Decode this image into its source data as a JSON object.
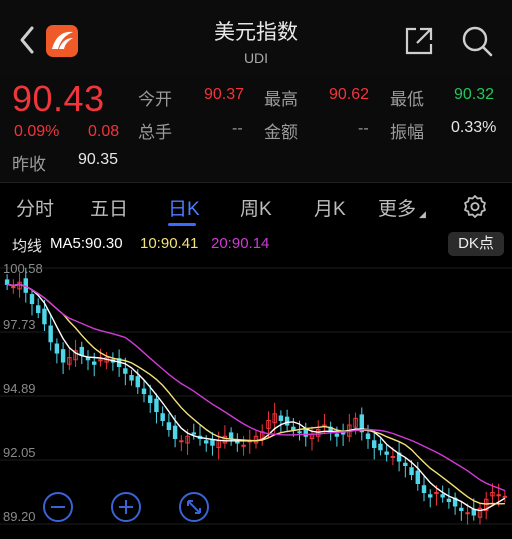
{
  "header": {
    "title": "美元指数",
    "subtitle": "UDI"
  },
  "quote": {
    "price": "90.43",
    "change_pct": "0.09%",
    "change": "0.08",
    "open_label": "今开",
    "open": "90.37",
    "high_label": "最高",
    "high": "90.62",
    "low_label": "最低",
    "low": "90.32",
    "volume_label": "总手",
    "volume": "--",
    "amount_label": "金额",
    "amount": "--",
    "amplitude_label": "振幅",
    "amplitude": "0.33%",
    "prev_close_label": "昨收",
    "prev_close": "90.35"
  },
  "tabs": [
    {
      "label": "分时"
    },
    {
      "label": "五日"
    },
    {
      "label": "日K"
    },
    {
      "label": "周K"
    },
    {
      "label": "月K"
    },
    {
      "label": "更多"
    }
  ],
  "active_tab": "日K",
  "ma": {
    "label": "均线",
    "ma5": "MA5:90.30",
    "ma10": "10:90.41",
    "ma20": "20:90.14",
    "dk_button": "DK点"
  },
  "colors": {
    "up": "#f0353b",
    "down": "#4fd6e8",
    "ma5": "#ffffff",
    "ma10": "#f3e27a",
    "ma20": "#d23ad8",
    "accent": "#3a6bff"
  },
  "icons": [
    "back-icon",
    "app-logo-icon",
    "share-icon",
    "search-icon",
    "settings-icon",
    "zoom-out-icon",
    "zoom-in-icon",
    "expand-icon"
  ],
  "chart_data": {
    "type": "candlestick",
    "y_tick_labels": [
      "100.58",
      "97.73",
      "94.89",
      "92.05",
      "89.20"
    ],
    "ylim": [
      89.2,
      100.58
    ],
    "close": [
      99.85,
      99.75,
      99.95,
      99.5,
      99.0,
      98.6,
      98.1,
      97.3,
      96.8,
      96.4,
      96.6,
      96.9,
      96.7,
      96.5,
      96.3,
      96.5,
      96.6,
      96.4,
      96.2,
      95.9,
      95.6,
      95.3,
      95.0,
      94.6,
      94.2,
      93.8,
      93.4,
      93.0,
      92.9,
      93.1,
      93.2,
      93.0,
      92.8,
      92.7,
      92.9,
      93.1,
      93.0,
      92.8,
      92.7,
      92.9,
      93.1,
      93.3,
      93.8,
      94.1,
      93.8,
      93.6,
      93.4,
      93.3,
      93.1,
      93.2,
      93.4,
      93.6,
      93.3,
      93.1,
      93.2,
      93.6,
      93.9,
      93.3,
      93.0,
      92.6,
      92.5,
      92.3,
      92.2,
      92.0,
      91.8,
      91.4,
      91.0,
      90.6,
      90.4,
      90.6,
      90.4,
      90.2,
      90.0,
      89.8,
      89.7,
      89.6,
      89.9,
      90.3,
      90.6,
      90.5,
      90.43
    ],
    "ma5_last": 90.3,
    "ma10_last": 90.41,
    "ma20_last": 90.14
  }
}
